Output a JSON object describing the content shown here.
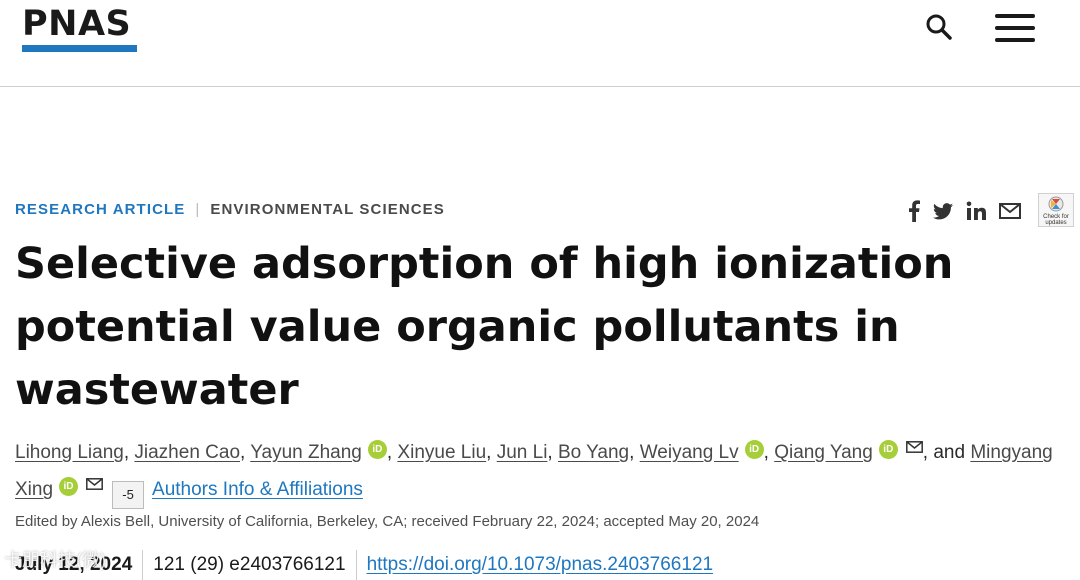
{
  "header": {
    "logo": "PNAS",
    "search_icon": "search-icon",
    "menu_icon": "hamburger-menu-icon",
    "brand_color": "#1f77c0"
  },
  "article": {
    "type": "RESEARCH ARTICLE",
    "separator": "|",
    "subject": "ENVIRONMENTAL SCIENCES",
    "title": "Selective adsorption of high ionization potential value organic pollutants in wastewater",
    "authors": [
      {
        "name": "Lihong Liang",
        "sep": ", "
      },
      {
        "name": "Jiazhen Cao",
        "sep": ", "
      },
      {
        "name": "Yayun Zhang",
        "orcid": "iD",
        "sep": ", "
      },
      {
        "name": "Xinyue Liu",
        "sep": ", "
      },
      {
        "name": "Jun Li",
        "sep": ", "
      },
      {
        "name": "Bo Yang",
        "sep": ", "
      },
      {
        "name": "Weiyang Lv",
        "orcid": "iD",
        "sep": ", "
      },
      {
        "name": "Qiang Yang",
        "orcid": "iD",
        "mail": true,
        "sep": ", and "
      },
      {
        "name": "Mingyang Xing",
        "orcid": "iD",
        "mail": true,
        "sep": ""
      }
    ],
    "more_authors_label": "-5",
    "affiliations_link": "Authors Info & Affiliations",
    "edited_by": "Edited by Alexis Bell, University of California, Berkeley, CA; received February 22, 2024; accepted May 20, 2024",
    "date": "July 12, 2024",
    "citation": "121 (29) e2403766121",
    "doi": "https://doi.org/10.1073/pnas.2403766121"
  },
  "share": {
    "icons": [
      "facebook-icon",
      "twitter-icon",
      "linkedin-icon",
      "email-icon"
    ],
    "crossmark_label": "Check for updates"
  },
  "watermark": "卡朋科技(微)"
}
